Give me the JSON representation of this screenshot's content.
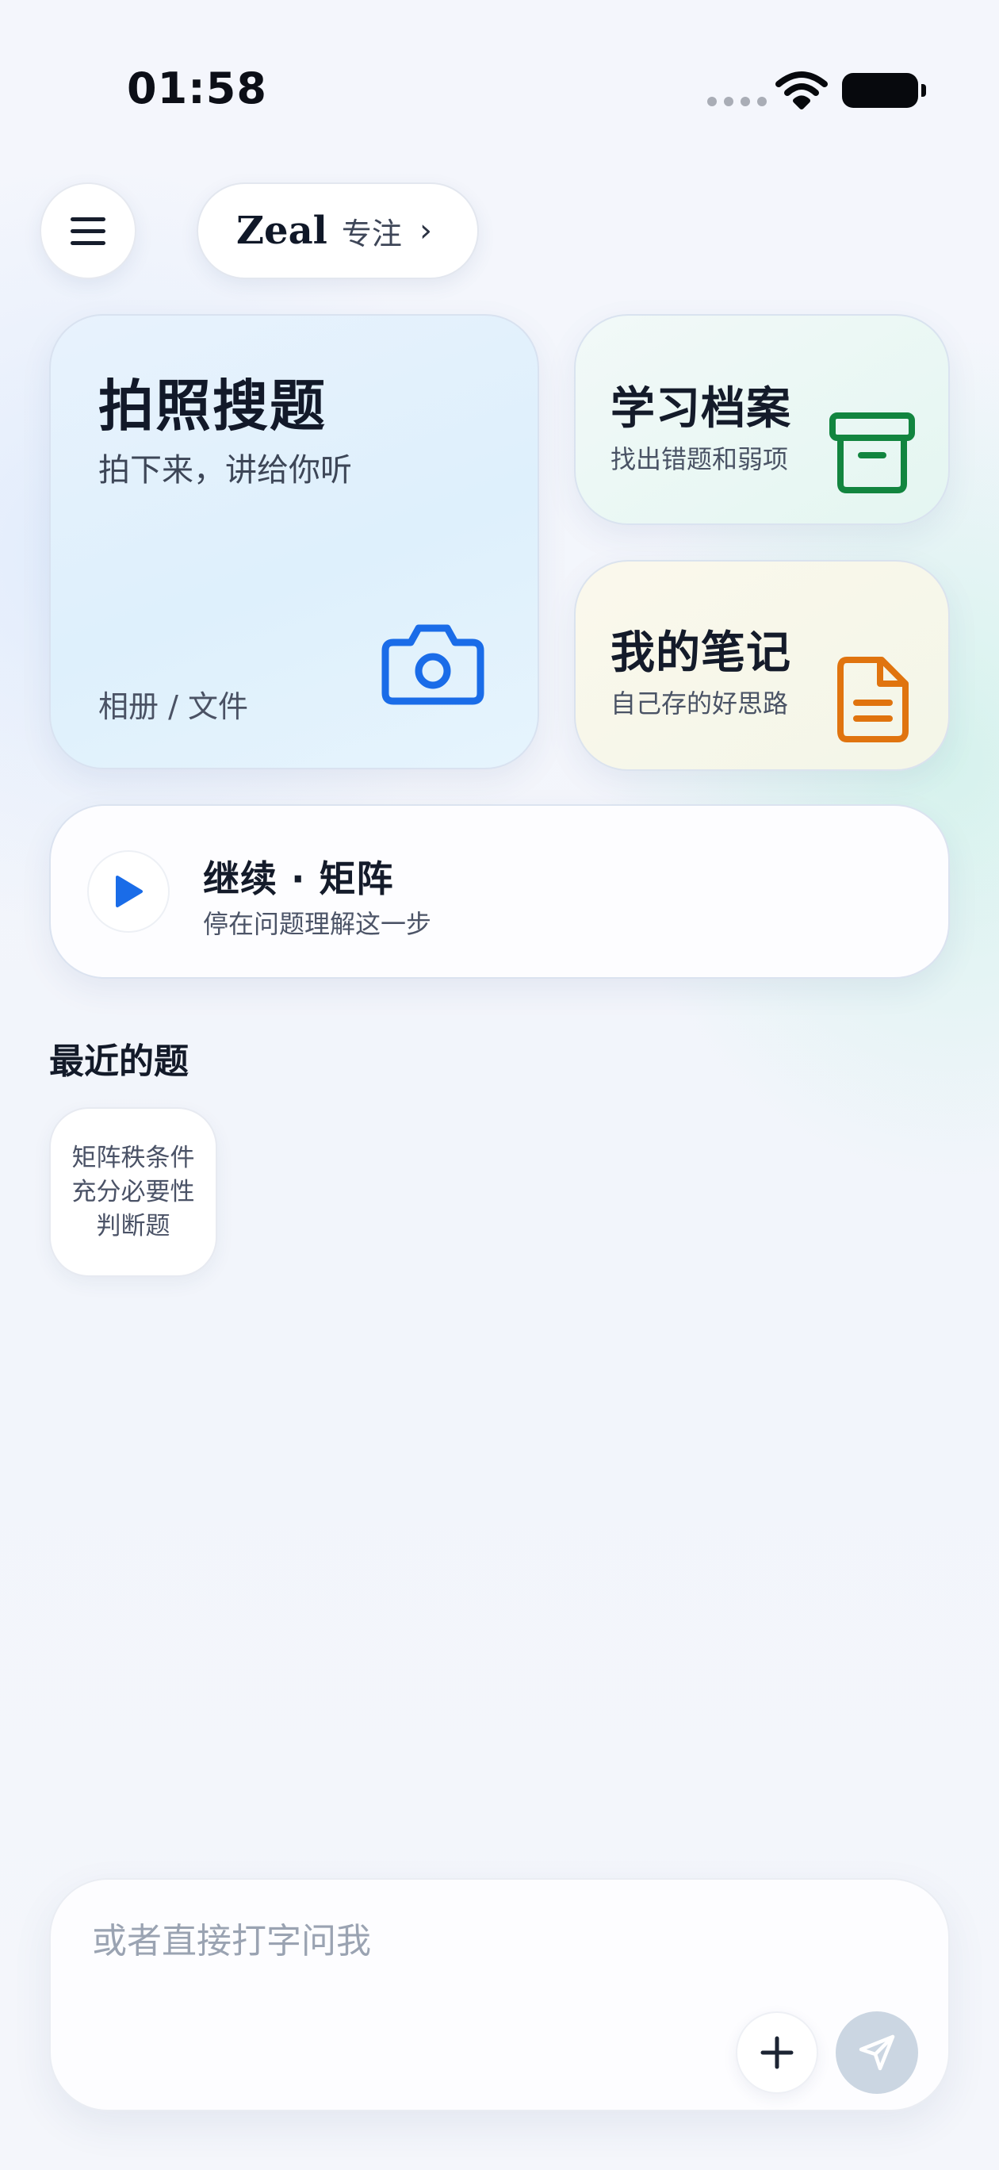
{
  "status_bar": {
    "time": "01:58",
    "icons": [
      "signal-dots-icon",
      "wifi-icon",
      "battery-icon"
    ]
  },
  "header": {
    "menu_icon": "hamburger-menu-icon",
    "brand": "Zeal",
    "mode": "专注",
    "chevron": "›"
  },
  "cards": {
    "photo_search": {
      "title": "拍照搜题",
      "subtitle": "拍下来，讲给你听",
      "footer": "相册 / 文件",
      "icon": "camera-icon",
      "accent": "#1a6ce8"
    },
    "study_archive": {
      "title": "学习档案",
      "subtitle": "找出错题和弱项",
      "icon": "archive-box-icon",
      "accent": "#12853f"
    },
    "my_notes": {
      "title": "我的笔记",
      "subtitle": "自己存的好思路",
      "icon": "document-icon",
      "accent": "#e0740f"
    }
  },
  "continue": {
    "title": "继续 · 矩阵",
    "subtitle": "停在问题理解这一步",
    "icon": "play-icon",
    "accent": "#1a6ce8"
  },
  "recent": {
    "heading": "最近的题",
    "items": [
      {
        "text": "矩阵秩条件充分必要性判断题"
      }
    ]
  },
  "composer": {
    "placeholder": "或者直接打字问我",
    "value": "",
    "add_icon": "plus-icon",
    "send_icon": "send-icon"
  }
}
